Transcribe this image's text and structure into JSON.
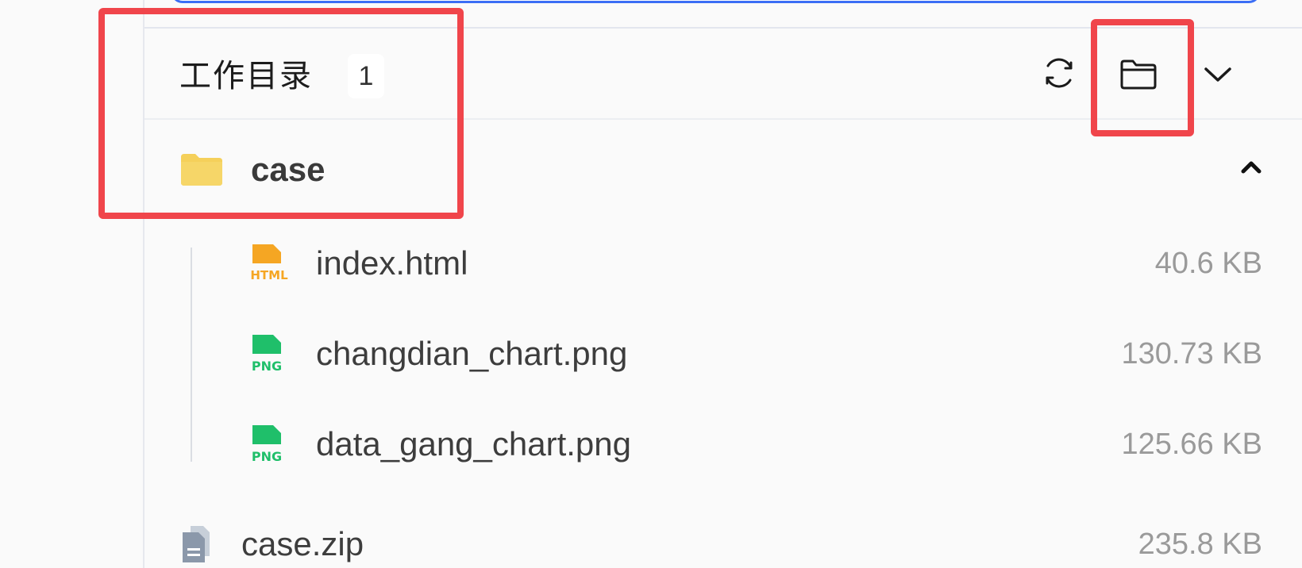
{
  "section": {
    "title": "工作目录",
    "count": "1"
  },
  "toolbar": {
    "refresh_icon": "refresh-icon",
    "open_folder_icon": "folder-icon",
    "collapse_icon": "chevron-down-icon"
  },
  "folder": {
    "name": "case",
    "expanded": true,
    "files": [
      {
        "name": "index.html",
        "type_label": "HTML",
        "size": "40.6 KB",
        "color": "#f5a623"
      },
      {
        "name": "changdian_chart.png",
        "type_label": "PNG",
        "size": "130.73 KB",
        "color": "#1fbf6a"
      },
      {
        "name": "data_gang_chart.png",
        "type_label": "PNG",
        "size": "125.66 KB",
        "color": "#1fbf6a"
      }
    ]
  },
  "archive": {
    "name": "case.zip",
    "size": "235.8 KB"
  },
  "colors": {
    "accent": "#3b6ef5",
    "highlight": "#f0454b",
    "folder": "#f5d05a"
  }
}
